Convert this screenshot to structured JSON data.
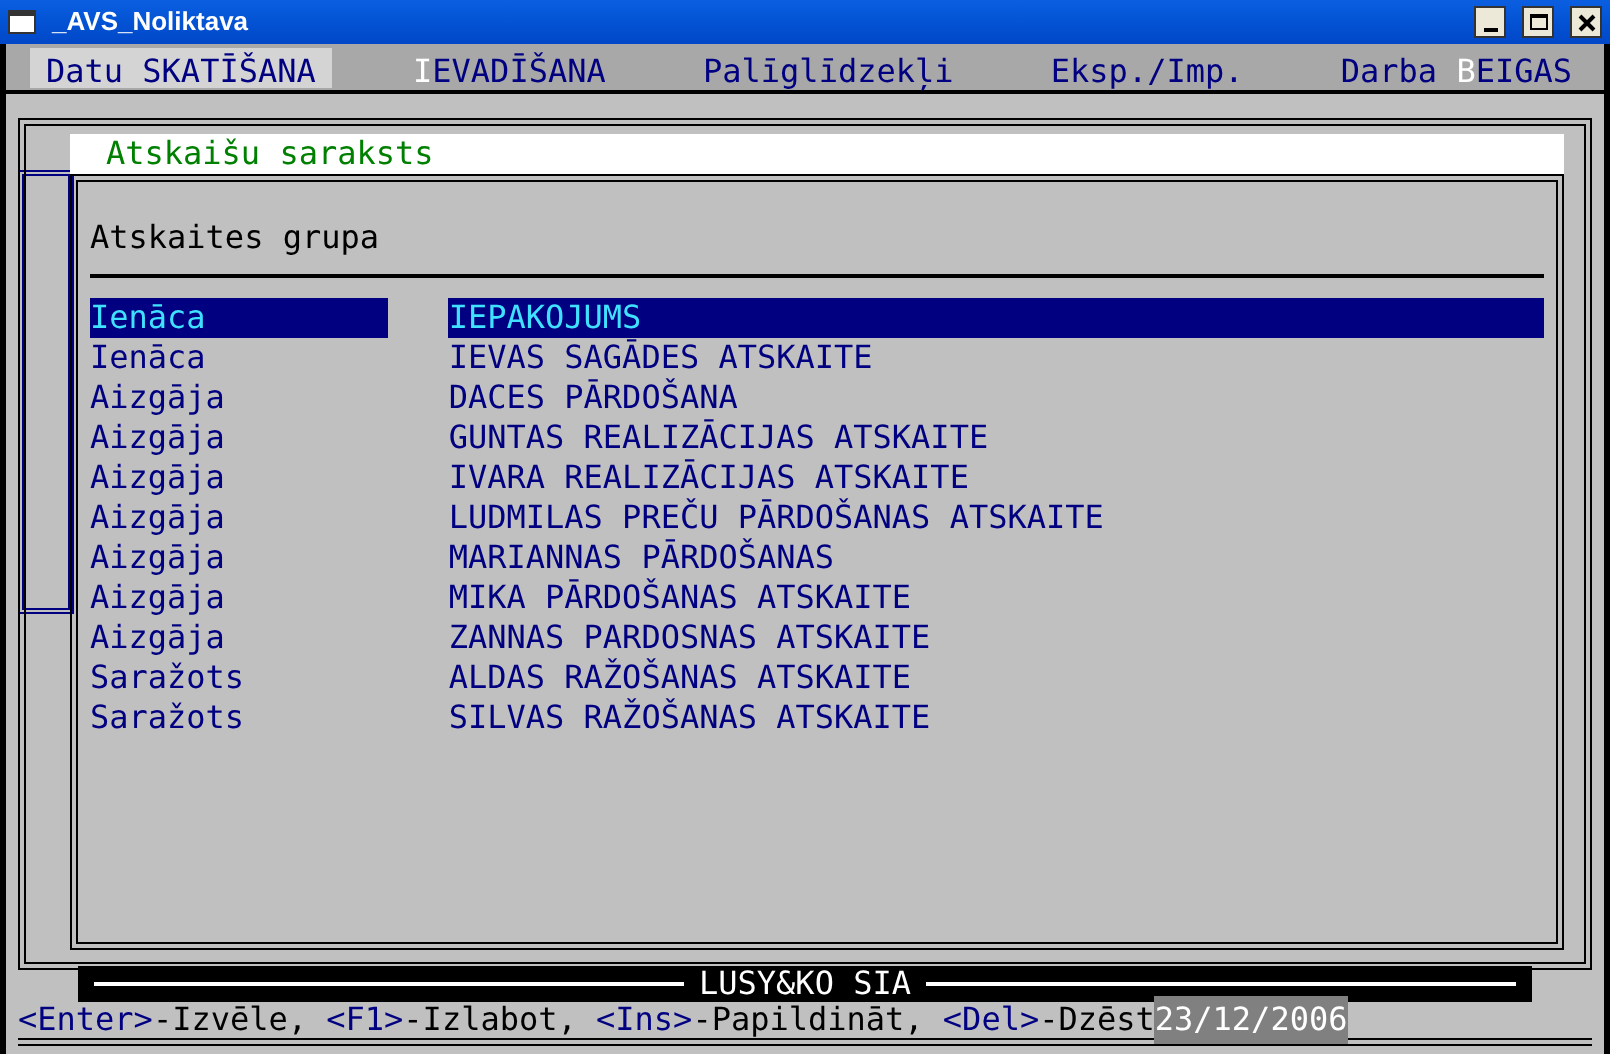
{
  "window": {
    "title": "_AVS_Noliktava"
  },
  "menu": [
    {
      "before": "Datu SKATĪŠANA",
      "selected": true
    },
    {
      "hotkey": "I",
      "after": "EVADĪŠANA",
      "selected": false
    },
    {
      "before": "Palīglīdzekļi",
      "selected": false
    },
    {
      "before": "Eksp./Imp.",
      "selected": false
    },
    {
      "before": "Darba ",
      "hotkey": "B",
      "after": "EIGAS",
      "selected": false
    }
  ],
  "dialog": {
    "title": "Atskaišu saraksts",
    "header": "Atskaites grupa",
    "rows": [
      {
        "group": "Ienāca",
        "name": "IEPAKOJUMS",
        "selected": true
      },
      {
        "group": "Ienāca",
        "name": "IEVAS SAGĀDES ATSKAITE",
        "selected": false
      },
      {
        "group": "Aizgāja",
        "name": "DACES PĀRDOŠANA",
        "selected": false
      },
      {
        "group": "Aizgāja",
        "name": "GUNTAS REALIZĀCIJAS ATSKAITE",
        "selected": false
      },
      {
        "group": "Aizgāja",
        "name": "IVARA REALIZĀCIJAS ATSKAITE",
        "selected": false
      },
      {
        "group": "Aizgāja",
        "name": "LUDMILAS PREČU PĀRDOŠANAS ATSKAITE",
        "selected": false
      },
      {
        "group": "Aizgāja",
        "name": "MARIANNAS PĀRDOŠANAS",
        "selected": false
      },
      {
        "group": "Aizgāja",
        "name": "MIKA PĀRDOŠANAS ATSKAITE",
        "selected": false
      },
      {
        "group": "Aizgāja",
        "name": "ZANNAS PARDOSNAS ATSKAITE",
        "selected": false
      },
      {
        "group": "Saražots",
        "name": "ALDAS RAŽOŠANAS ATSKAITE",
        "selected": false
      },
      {
        "group": "Saražots",
        "name": "SILVAS RAŽOŠANAS ATSKAITE",
        "selected": false
      }
    ]
  },
  "company": "LUSY&KO SIA",
  "status_bar": {
    "keys": [
      {
        "key": "<Enter>",
        "action": "-Izvēle,"
      },
      {
        "key": "<F1>",
        "action": "-Izlabot,"
      },
      {
        "key": "<Ins>",
        "action": "-Papildināt,"
      },
      {
        "key": "<Del>",
        "action": "-Dzēst"
      }
    ],
    "date": "23/12/2006"
  }
}
